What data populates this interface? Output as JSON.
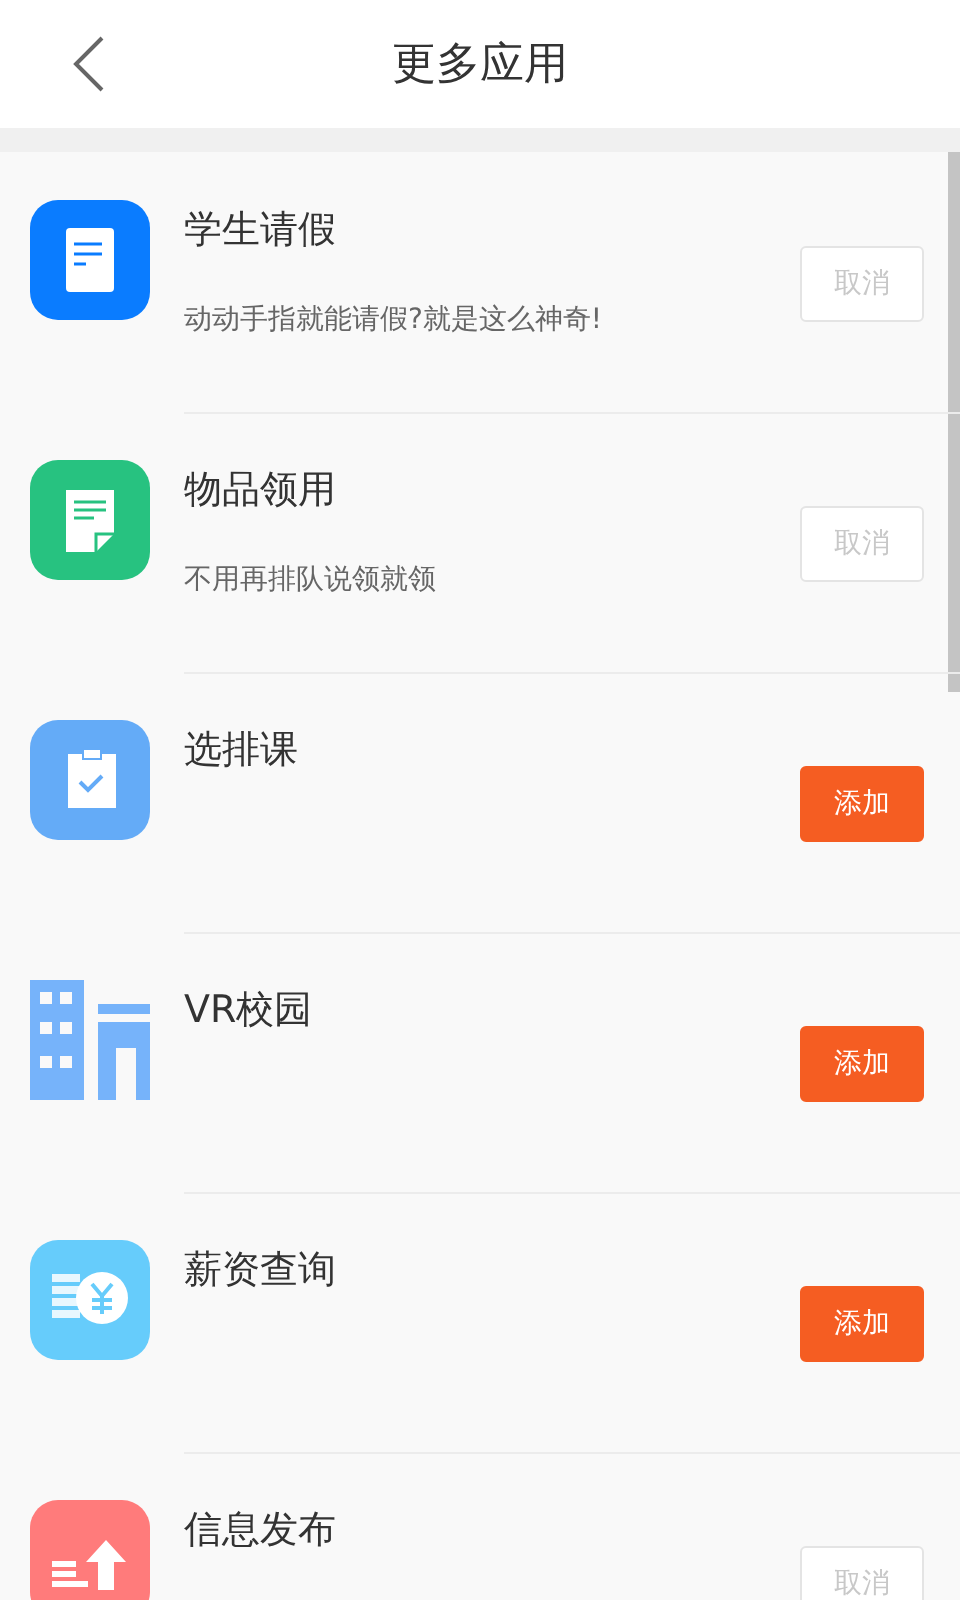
{
  "header": {
    "title": "更多应用"
  },
  "apps": [
    {
      "kind": "document",
      "color": "#0a7cff",
      "title": "学生请假",
      "description": "动动手指就能请假?就是这么神奇!",
      "added": true,
      "button": "取消"
    },
    {
      "kind": "form",
      "color": "#27c280",
      "title": "物品领用",
      "description": "不用再排队说领就领",
      "added": true,
      "button": "取消"
    },
    {
      "kind": "clipboard",
      "color": "#64abf7",
      "title": "选排课",
      "added": false,
      "button": "添加"
    },
    {
      "kind": "building",
      "color": "#76b3fa",
      "title": "VR校园",
      "added": false,
      "button": "添加"
    },
    {
      "kind": "coin",
      "color": "#66ccfb",
      "title": "薪资查询",
      "added": false,
      "button": "添加"
    },
    {
      "kind": "publish",
      "color": "#ff7b7b",
      "title": "信息发布",
      "added": true,
      "button": "取消"
    }
  ]
}
